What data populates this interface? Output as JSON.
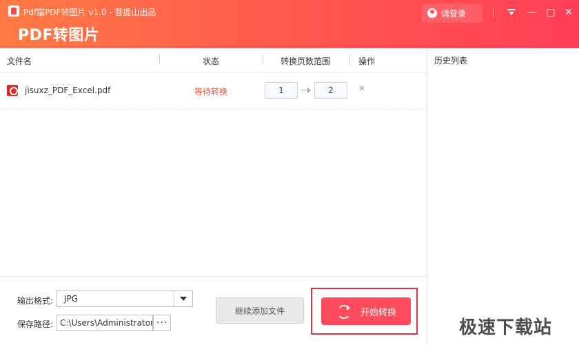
{
  "window": {
    "title": "Pdf猫PDF转图片 v1.0 - 菩提山出品",
    "brand_title": "PDF转图片"
  },
  "header": {
    "login_label": "请登录"
  },
  "table": {
    "columns": [
      "文件名",
      "状态",
      "转换页数范围",
      "操作"
    ],
    "rows": [
      {
        "filename": "jisuxz_PDF_Excel.pdf",
        "status": "等待转换",
        "range_start": "1",
        "range_end": "2"
      }
    ]
  },
  "bottom": {
    "format_label": "输出格式:",
    "format_value": "JPG",
    "path_label": "保存路径:",
    "path_value": "C:\\Users\\Administrator",
    "browse_label": "···",
    "add_file_label": "继续添加文件",
    "start_label": "开始转换"
  },
  "right_panel": {
    "title": "历史列表"
  },
  "watermark": "极速下载站",
  "colors": {
    "header_gradient_left": "#ff7b45",
    "header_gradient_right": "#ff3f58",
    "primary_button": "#ff4b5b",
    "status_waiting": "#d85a3f",
    "highlight_border": "#d9363e"
  }
}
